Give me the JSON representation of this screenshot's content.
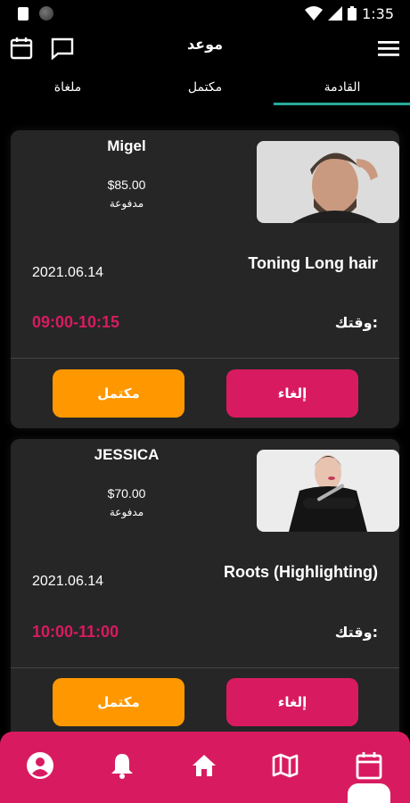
{
  "status_bar": {
    "time": "1:35"
  },
  "header": {
    "title": "موعد"
  },
  "tabs": [
    {
      "label": "القادمة",
      "active": true
    },
    {
      "label": "مكتمل",
      "active": false
    },
    {
      "label": "ملغاة",
      "active": false
    }
  ],
  "appointments": [
    {
      "client": "Migel",
      "price": "$85.00",
      "payment_status": "مدفوعة",
      "service": "Toning Long hair",
      "date": "2021.06.14",
      "time_label": "وقتك:",
      "time": "09:00-10:15",
      "complete_label": "مكتمل",
      "cancel_label": "إلغاء"
    },
    {
      "client": "JESSICA",
      "price": "$70.00",
      "payment_status": "مدفوعة",
      "service": "Roots (Highlighting)",
      "date": "2021.06.14",
      "time_label": "وقتك:",
      "time": "10:00-11:00",
      "complete_label": "مكتمل",
      "cancel_label": "إلغاء"
    }
  ],
  "bottom_nav": [
    "profile-icon",
    "bell-icon",
    "home-icon",
    "map-icon",
    "calendar-icon"
  ],
  "colors": {
    "accent": "#d81b60",
    "complete": "#ff9800",
    "tab_indicator": "#27a99a",
    "card": "#262626"
  }
}
